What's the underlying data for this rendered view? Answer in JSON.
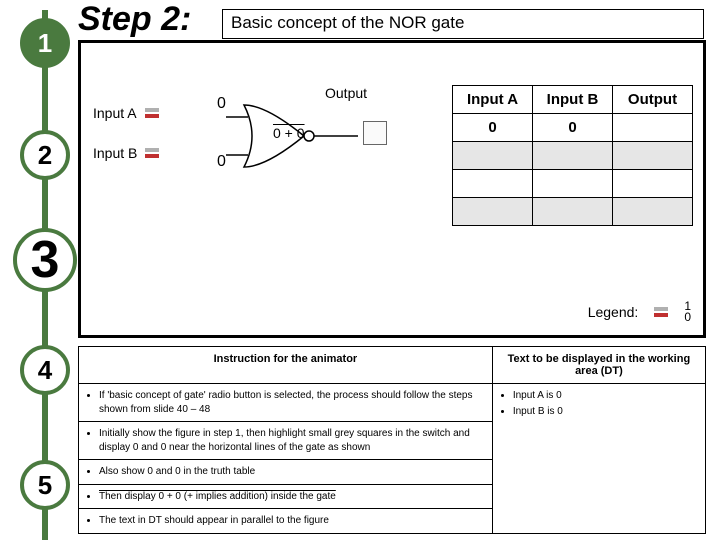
{
  "header": {
    "step_label": "Step 2:",
    "concept_title": "Basic concept of the NOR gate"
  },
  "timeline": {
    "steps": [
      "1",
      "2",
      "3",
      "4",
      "5"
    ],
    "active_index": 2
  },
  "diagram": {
    "input_a_label": "Input A",
    "input_b_label": "Input B",
    "input_a_value": "0",
    "input_b_value": "0",
    "output_label": "Output",
    "gate_expression": "0 + 0"
  },
  "truth_table": {
    "headers": [
      "Input A",
      "Input B",
      "Output"
    ],
    "rows": [
      [
        "0",
        "0",
        ""
      ],
      [
        "",
        "",
        ""
      ],
      [
        "",
        "",
        ""
      ],
      [
        "",
        "",
        ""
      ]
    ]
  },
  "legend": {
    "label": "Legend:",
    "high": "1",
    "low": "0"
  },
  "instructions": {
    "left_header": "Instruction for the animator",
    "right_header": "Text to be displayed in the working area (DT)",
    "left_items": [
      "If 'basic concept of gate' radio button is selected, the process should follow the steps shown from slide 40 – 48",
      "Initially show the figure in step 1, then highlight small grey squares in the switch and display 0 and 0 near the horizontal lines of the gate as shown",
      "Also show 0 and 0 in the truth table",
      "Then display 0 + 0 (+ implies addition) inside the gate",
      "The text in DT should appear in parallel to the figure"
    ],
    "right_items": [
      "Input A is 0",
      "Input B is 0"
    ]
  },
  "chart_data": {
    "type": "table",
    "title": "NOR gate truth table (partial, step 2)",
    "columns": [
      "Input A",
      "Input B",
      "Output"
    ],
    "rows": [
      {
        "Input A": 0,
        "Input B": 0,
        "Output": null
      }
    ],
    "gate": "NOR",
    "shown_inputs": {
      "A": 0,
      "B": 0
    },
    "gate_internal_expression": "0 + 0 (overlined)"
  }
}
